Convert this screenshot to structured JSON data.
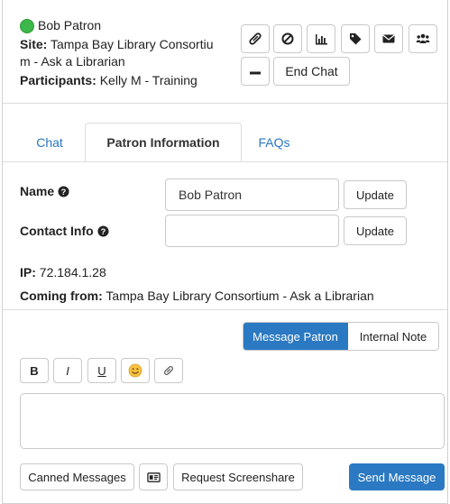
{
  "header": {
    "patron_name": "Bob Patron",
    "site_label": "Site:",
    "site_line1": "Tampa Bay Library Consortiu",
    "site_line2": "m - Ask a Librarian",
    "participants_label": "Participants:",
    "participants_value": "Kelly M - Training",
    "status_color": "#3cb84a",
    "actions": [
      "paperclip-icon",
      "block-icon",
      "bar-chart-icon",
      "tag-icon",
      "envelope-icon",
      "users-icon",
      "minimize-icon"
    ],
    "end_chat_label": "End Chat"
  },
  "tabs": [
    {
      "label": "Chat",
      "active": false
    },
    {
      "label": "Patron Information",
      "active": true
    },
    {
      "label": "FAQs",
      "active": false
    }
  ],
  "patron_info": {
    "name_label": "Name",
    "name_value": "Bob Patron",
    "contact_label": "Contact Info",
    "contact_value": "",
    "update_label": "Update",
    "ip_label": "IP:",
    "ip_value": "72.184.1.28",
    "coming_from_label": "Coming from:",
    "coming_from_value": "Tampa Bay Library Consortium - Ask a Librarian"
  },
  "composer": {
    "mode_message": "Message Patron",
    "mode_note": "Internal Note",
    "bold": "B",
    "italic": "I",
    "underline": "U",
    "message_value": "",
    "canned_label": "Canned Messages",
    "screenshare_label": "Request Screenshare",
    "send_label": "Send Message",
    "accent_color": "#2b79c2"
  }
}
